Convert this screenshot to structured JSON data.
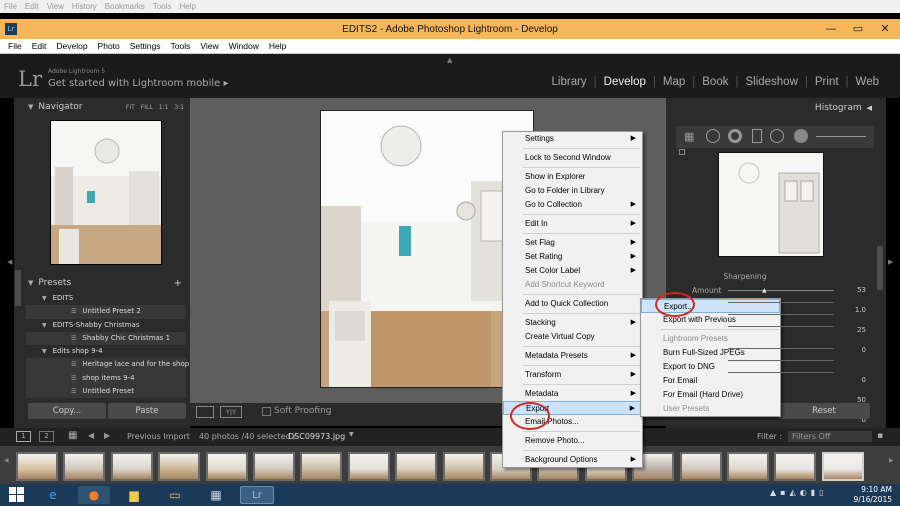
{
  "ghost_menu": [
    "File",
    "Edit",
    "View",
    "History",
    "Bookmarks",
    "Tools",
    "Help"
  ],
  "window": {
    "title": "EDITS2 - Adobe Photoshop Lightroom - Develop",
    "app_icon": "Lr"
  },
  "menubar": [
    "File",
    "Edit",
    "Develop",
    "Photo",
    "Settings",
    "Tools",
    "View",
    "Window",
    "Help"
  ],
  "identity": {
    "logo": "Lr",
    "version": "Adobe Lightroom 5",
    "mobile": "Get started with Lightroom mobile ▸"
  },
  "modules": [
    "Library",
    "Develop",
    "Map",
    "Book",
    "Slideshow",
    "Print",
    "Web"
  ],
  "active_module": "Develop",
  "navigator": {
    "title": "Navigator",
    "zoom": [
      "FIT",
      "FILL",
      "1:1",
      "3:1"
    ]
  },
  "presets": {
    "title": "Presets",
    "rows": [
      {
        "type": "folder",
        "label": "EDITS"
      },
      {
        "type": "item",
        "label": "Untitled Preset 2"
      },
      {
        "type": "folder",
        "label": "EDITS-Shabby Christmas"
      },
      {
        "type": "item",
        "label": "Shabby Chic Christmas 1"
      },
      {
        "type": "folder",
        "label": "Edits shop 9-4"
      },
      {
        "type": "item",
        "label": "Heritage lace and for the shop"
      },
      {
        "type": "item",
        "label": "shop items 9-4"
      },
      {
        "type": "item",
        "label": "Untitled Preset"
      }
    ]
  },
  "left_buttons": {
    "copy": "Copy...",
    "paste": "Paste"
  },
  "toolbar": {
    "soft_proofing": "Soft Proofing",
    "yy": "Y|Y"
  },
  "right_panel": {
    "histogram": "Histogram",
    "sharpening": "Sharpening",
    "amount_label": "Amount",
    "values": [
      "53",
      "1.0",
      "25",
      "0",
      "0",
      "50",
      "0"
    ],
    "reset": "Reset"
  },
  "filmstrip": {
    "pages": [
      "1",
      "2"
    ],
    "source": "Previous Import",
    "count": "40 photos /40 selected /",
    "filename": "DSC09973.jpg",
    "filter_label": "Filter :",
    "filter_value": "Filters Off"
  },
  "context_menu": [
    {
      "label": "Settings",
      "arrow": true
    },
    {
      "sep": true
    },
    {
      "label": "Lock to Second Window"
    },
    {
      "sep": true
    },
    {
      "label": "Show in Explorer"
    },
    {
      "label": "Go to Folder in Library"
    },
    {
      "label": "Go to Collection",
      "arrow": true
    },
    {
      "sep": true
    },
    {
      "label": "Edit In",
      "arrow": true
    },
    {
      "sep": true
    },
    {
      "label": "Set Flag",
      "arrow": true
    },
    {
      "label": "Set Rating",
      "arrow": true
    },
    {
      "label": "Set Color Label",
      "arrow": true
    },
    {
      "label": "Add Shortcut Keyword",
      "disabled": true
    },
    {
      "sep": true
    },
    {
      "label": "Add to Quick Collection"
    },
    {
      "sep": true
    },
    {
      "label": "Stacking",
      "arrow": true
    },
    {
      "label": "Create Virtual Copy"
    },
    {
      "sep": true
    },
    {
      "label": "Metadata Presets",
      "arrow": true
    },
    {
      "sep": true
    },
    {
      "label": "Transform",
      "arrow": true
    },
    {
      "sep": true
    },
    {
      "label": "Metadata",
      "arrow": true
    },
    {
      "label": "Export",
      "arrow": true,
      "highlight": true
    },
    {
      "label": "Email Photos..."
    },
    {
      "sep": true
    },
    {
      "label": "Remove Photo..."
    },
    {
      "sep": true
    },
    {
      "label": "Background Options",
      "arrow": true
    }
  ],
  "export_submenu": [
    {
      "label": "Export...",
      "highlight": true
    },
    {
      "label": "Export with Previous"
    },
    {
      "sep": true
    },
    {
      "label": "Lightroom Presets",
      "header": true
    },
    {
      "label": "Burn Full-Sized JPEGs"
    },
    {
      "label": "Export to DNG"
    },
    {
      "label": "For Email"
    },
    {
      "label": "For Email (Hard Drive)"
    },
    {
      "label": "User Presets",
      "header": true
    }
  ],
  "clock": {
    "time": "9:10 AM",
    "date": "9/16/2015"
  },
  "colors": {
    "accent_titlebar": "#f7b65b",
    "highlight": "#cde3f7",
    "annotation": "#d0281f",
    "taskbar": "#1b3a57"
  }
}
